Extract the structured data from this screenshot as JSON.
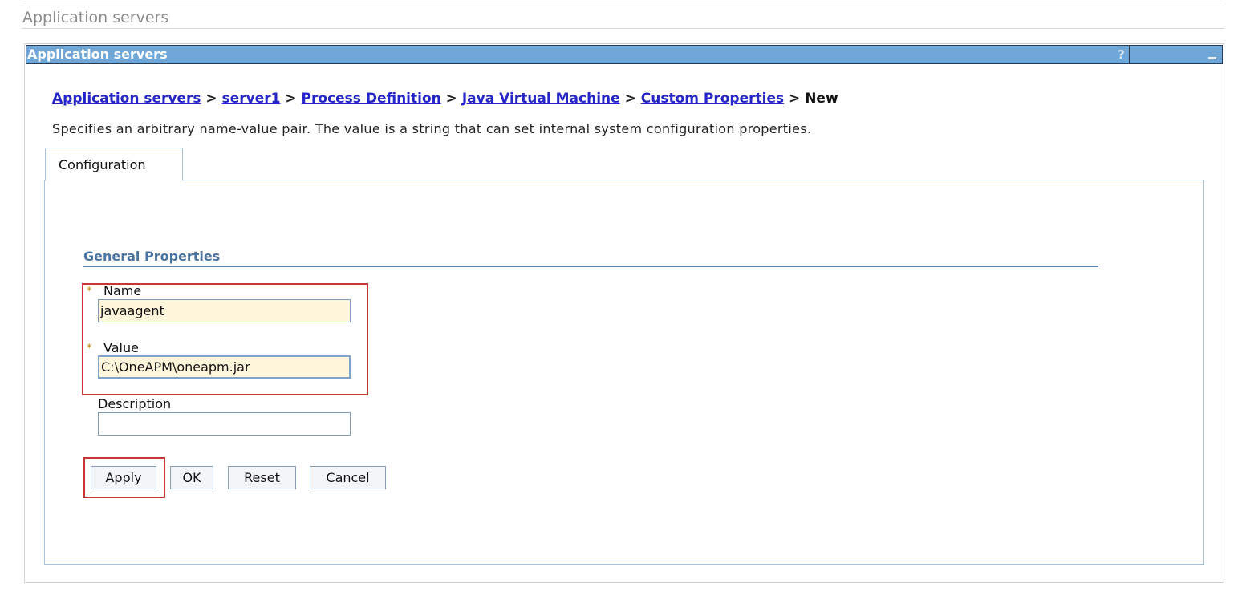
{
  "page": {
    "title": "Application servers"
  },
  "portlet": {
    "title": "Application servers",
    "help_symbol": "?"
  },
  "breadcrumb": {
    "items": [
      "Application servers",
      "server1",
      "Process Definition",
      "Java Virtual Machine",
      "Custom Properties"
    ],
    "separator": ">",
    "current": "New"
  },
  "description": "Specifies an arbitrary name-value pair. The value is a string that can set internal system configuration properties.",
  "tabs": [
    {
      "label": "Configuration",
      "selected": true
    }
  ],
  "general_properties": {
    "title": "General Properties",
    "required_marker": "*",
    "name_label": "Name",
    "name_value": "javaagent",
    "value_label": "Value",
    "value_value": "C:\\OneAPM\\oneapm.jar",
    "description_label": "Description",
    "description_value": ""
  },
  "buttons": {
    "apply": "Apply",
    "ok": "OK",
    "reset": "Reset",
    "cancel": "Cancel"
  },
  "colors": {
    "header_bg": "#6fa6d8",
    "link": "#2626c8",
    "highlight": "#c8343a",
    "input_bg": "#fff6dc"
  },
  "icons": {
    "help": "help-icon",
    "minimize": "minimize-icon",
    "required": "required-star-icon"
  }
}
